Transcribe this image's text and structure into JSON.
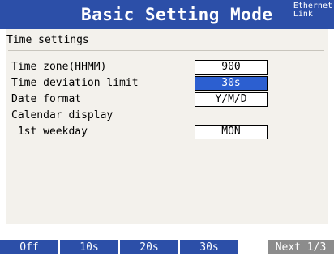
{
  "header": {
    "title": "Basic Setting Mode",
    "ethernet_line1": "Ethernet",
    "ethernet_line2": "Link"
  },
  "section": {
    "title": "Time settings"
  },
  "rows": [
    {
      "label": "Time zone(HHMM)",
      "value": "900",
      "selected": false
    },
    {
      "label": "Time deviation limit",
      "value": "30s",
      "selected": true
    },
    {
      "label": "Date format",
      "value": "Y/M/D",
      "selected": false
    },
    {
      "label": "Calendar display",
      "value": null
    },
    {
      "label": " 1st weekday",
      "value": "MON",
      "selected": false
    }
  ],
  "softkeys": [
    "Off",
    "10s",
    "20s",
    "30s",
    "Next 1/3"
  ],
  "colors": {
    "header": "#2c4fa8",
    "selected": "#2c5fd0",
    "content_bg": "#f3f1ec",
    "next_key": "#8c8c8c"
  }
}
